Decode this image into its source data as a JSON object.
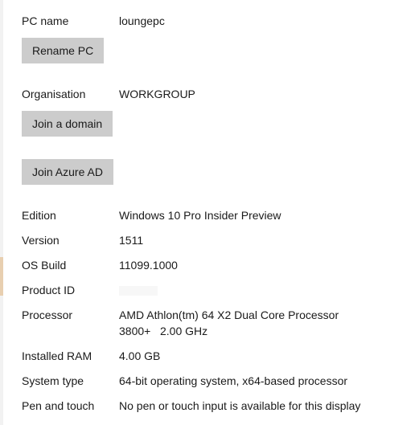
{
  "accent_color": "#e8cfb0",
  "pc_name": {
    "label": "PC name",
    "value": "loungepc",
    "button": "Rename PC"
  },
  "organisation": {
    "label": "Organisation",
    "value": "WORKGROUP",
    "join_domain": "Join a domain",
    "join_azure": "Join Azure AD"
  },
  "specs": {
    "edition": {
      "label": "Edition",
      "value": "Windows 10 Pro Insider Preview"
    },
    "version": {
      "label": "Version",
      "value": "1511"
    },
    "os_build": {
      "label": "OS Build",
      "value": "11099.1000"
    },
    "product_id": {
      "label": "Product ID",
      "value": ""
    },
    "processor": {
      "label": "Processor",
      "value_line1": "AMD Athlon(tm) 64 X2 Dual Core Processor",
      "value_line2": "3800+   2.00 GHz"
    },
    "ram": {
      "label": "Installed RAM",
      "value": "4.00 GB"
    },
    "system_type": {
      "label": "System type",
      "value": "64-bit operating system, x64-based processor"
    },
    "pen_touch": {
      "label": "Pen and touch",
      "value": "No pen or touch input is available for this display"
    }
  }
}
